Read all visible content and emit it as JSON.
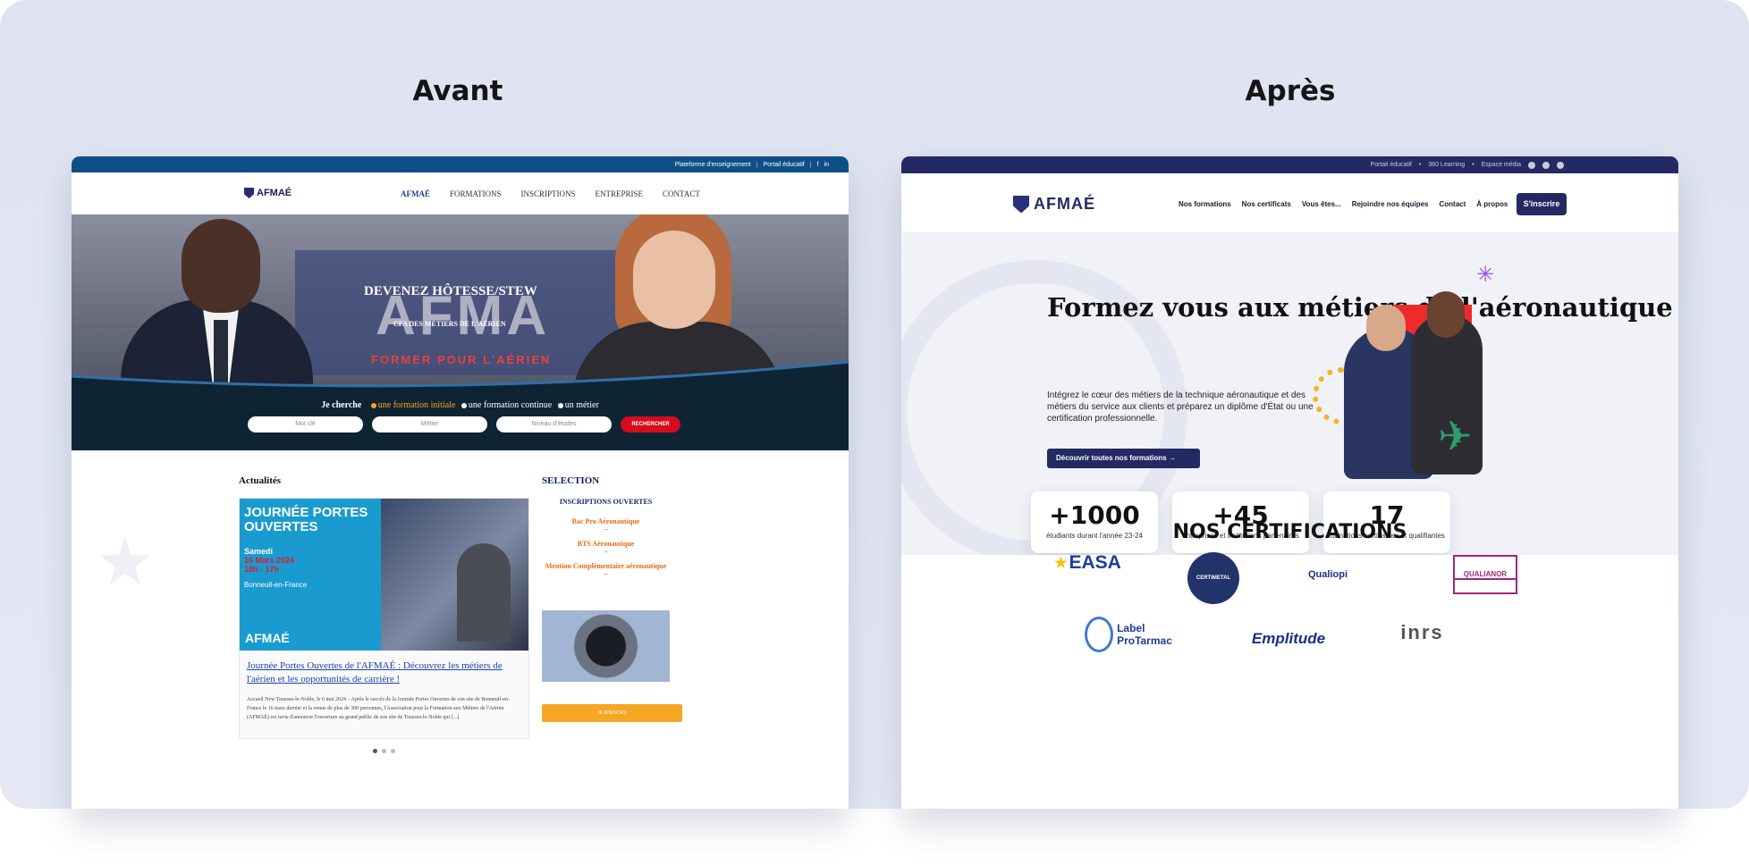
{
  "labels": {
    "before": "Avant",
    "after": "Après"
  },
  "before": {
    "topbar": {
      "items": [
        "Plateforme d'enseignement",
        "Portail éducatif",
        "f",
        "in"
      ]
    },
    "logo": "AFMAÉ",
    "nav": [
      "AFMAÉ",
      "FORMATIONS",
      "INSCRIPTIONS",
      "ENTREPRISE",
      "CONTACT"
    ],
    "hero": {
      "title": "DEVENEZ HÔTESSE/STEW",
      "subtitle": "CFA DES MÉTIERS DE L'AÉRIEN",
      "bg_word": "AFMA",
      "bg_tagline": "FORMER POUR L'AÉRIEN"
    },
    "search": {
      "label": "Je cherche",
      "options": [
        "une formation initiale",
        "une formation continue",
        "un métier"
      ],
      "selected": "une formation initiale",
      "fields": [
        "Mot clé",
        "Métier",
        "Niveau d'études"
      ],
      "button": "RECHERCHER"
    },
    "news": {
      "heading": "Actualités",
      "card_title": "JOURNÉE PORTES OUVERTES",
      "card_day": "Samedi",
      "card_date": "16 Mars 2024",
      "card_time": "10h - 17h",
      "card_place": "Bonneuil-en-France",
      "card_logo": "AFMAÉ",
      "link": "Journée Portes Ouvertes de l'AFMAÉ : Découvrez les métiers de l'aérien et les opportunités de carrière !",
      "excerpt": "Accueil New Toussus-le-Noble, le 6 mai 2024 – Après le succès de la Journée Portes Ouvertes de son site de Bonneuil-en-France le 16 mars dernier et la venue de plus de 300 personnes, l'Association pour la Formation aux Métiers de l'Aérien (AFMAÉ) est ravie d'annoncer l'ouverture au grand public de son site de Toussus-le-Noble qui [...]"
    },
    "selection": {
      "heading": "SELECTION",
      "title": "INSCRIPTIONS OUVERTES",
      "items": [
        "Bac Pro Aéronautique",
        "BTS Aéronautique",
        "Mention Complémentaire aéronautique"
      ],
      "button": "JE M'INSCRIS"
    }
  },
  "after": {
    "topbar": [
      "Portail éducatif",
      "360 Learning",
      "Espace média"
    ],
    "logo": "AFMAÉ",
    "nav": [
      "Nos formations",
      "Nos certificats",
      "Vous êtes...",
      "Rejoindre nos équipes",
      "Contact",
      "À propos"
    ],
    "signup": "S'inscrire",
    "hero": {
      "title": "Formez vous aux métiers de l'aéronautique",
      "text": "Intégrez le cœur des métiers de la technique aéronautique et des métiers du service aux clients et préparez un diplôme d'État ou une certification professionnelle.",
      "cta": "Découvrir toutes nos formations"
    },
    "stats": [
      {
        "value": "+1000",
        "label": "étudiants durant l'année 23-24"
      },
      {
        "value": "+45",
        "label": "entreprises et institutions partenaires"
      },
      {
        "value": "17",
        "label": "formations certifiantes et qualifiantes"
      }
    ],
    "certifications": {
      "heading": "NOS CERTIFICATIONS",
      "logos": [
        "EASA",
        "CERTIMETAL",
        "Qualiopi",
        "QUALIANOR",
        "Label ProTarmac",
        "Emplitude",
        "inrs"
      ]
    }
  },
  "colors": {
    "navy": "#232a63",
    "old_blue": "#0f4f87",
    "orange": "#f5a623",
    "red": "#d50c1d"
  }
}
